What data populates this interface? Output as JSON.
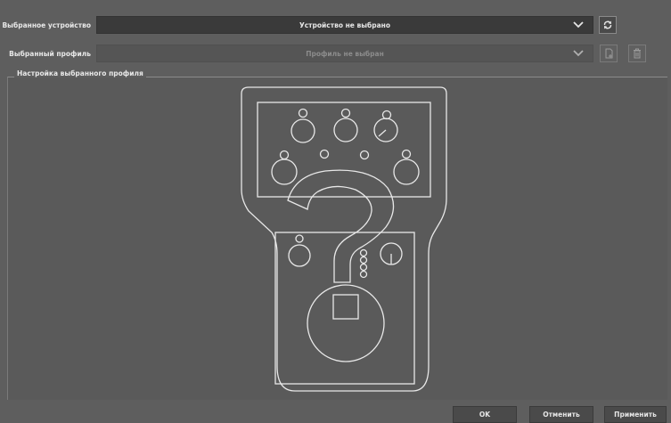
{
  "device": {
    "label": "Выбранное устройство",
    "value": "Устройство не выбрано",
    "refresh_icon": "refresh-icon"
  },
  "profile": {
    "label": "Выбранный профиль",
    "value": "Профиль не выбран",
    "new_icon": "new-document-icon",
    "delete_icon": "trash-icon"
  },
  "settings_group": {
    "title": "Настройка выбранного профиля",
    "placeholder_image": "unknown-device-question-mark"
  },
  "footer": {
    "ok_label": "OK",
    "cancel_label": "Отменить",
    "apply_label": "Применить"
  },
  "colors": {
    "background": "#5e5e5e",
    "combo_active": "#3a3a3a",
    "outline": "#e8e8e8"
  }
}
